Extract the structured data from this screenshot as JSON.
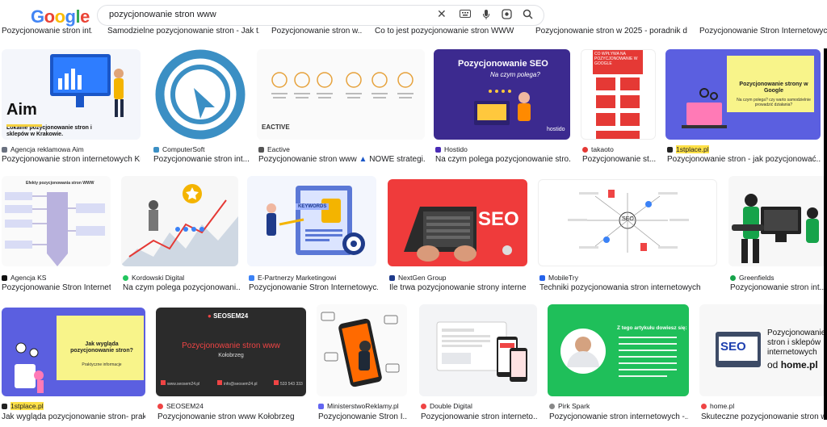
{
  "logo": {
    "text": "Google"
  },
  "search": {
    "query": "pozycjonowanie stron www"
  },
  "top_captions": [
    "Pozycjonowanie stron int...",
    "Samodzielne pozycjonowanie stron - Jak t...",
    "Pozycjonowanie stron w...",
    "Co to jest pozycjonowanie stron WWW ?",
    "Pozycjonowanie stron w 2025 - poradnik d...",
    "Pozycjonowanie Stron Internetowych -"
  ],
  "row1": [
    {
      "source": "Agencja reklamowa Aim",
      "caption": "Pozycjonowanie stron internetowych Kr...",
      "img_text": "Lokalne pozycjonowanie stron i sklepów w Krakowie.",
      "brand": "Aim"
    },
    {
      "source": "ComputerSoft",
      "caption": "Pozycjonowanie stron int..."
    },
    {
      "source": "Eactive",
      "caption": "Pozycjonowanie stron www",
      "caption2": "NOWE strategi...",
      "brand": "EACTIVE"
    },
    {
      "source": "Hostido",
      "caption": "Na czym polega pozycjonowanie stro...",
      "img_title": "Pozycjonowanie SEO",
      "img_sub": "Na czym polega?",
      "brand": "hostido"
    },
    {
      "source": "takaoto",
      "caption": "Pozycjonowanie st...",
      "img_text": "CO WPŁYWA NA POZYCJONOWANIE W GOOGLE"
    },
    {
      "source": "1stplace.pl",
      "caption": "Pozycjonowanie stron - jak pozycjonować...",
      "img_title": "Pozycjonowanie strony w Google",
      "img_sub": "Na czym polega? czy warto samodzielnie prowadzić działania?"
    }
  ],
  "row2": [
    {
      "source": "Agencja KS",
      "caption": "Pozycjonowanie Stron Internet...",
      "img_title": "Efekty pozycjonowania stron WWW"
    },
    {
      "source": "Kordowski Digital",
      "caption": "Na czym polega pozycjonowani..."
    },
    {
      "source": "E-Partnerzy Marketingowi",
      "caption": "Pozycjonowanie Stron Internetowyc...",
      "img_text": "KEYWORDS"
    },
    {
      "source": "NextGen Group",
      "caption": "Ile trwa pozycjonowanie strony interne...",
      "img_text": "SEO"
    },
    {
      "source": "MobileTry",
      "caption": "Techniki pozycjonowania stron internetowych",
      "img_text": "SEO"
    },
    {
      "source": "Greenfields",
      "caption": "Pozycjonowanie stron int..."
    }
  ],
  "row3": [
    {
      "source": "1stplace.pl",
      "caption": "Jak wygląda pozycjonowanie stron- prak...",
      "img_title": "Jak wygląda pozycjonowanie stron?",
      "img_sub": "Praktyczne informacje"
    },
    {
      "source": "SEOSEM24",
      "caption": "Pozycjonowanie stron www Kołobrzeg",
      "img_title": "Pozycjonowanie stron www",
      "img_sub": "Kołobrzeg",
      "brand": "SEOSEM24",
      "footer1": "www.seosem24.pl",
      "footer2": "info@seosem24.pl",
      "footer3": "533 543 333"
    },
    {
      "source": "MinisterstwoReklamy.pl",
      "caption": "Pozycjonowanie Stron I..."
    },
    {
      "source": "Double Digital",
      "caption": "Pozycjonowanie stron interneto..."
    },
    {
      "source": "Pirk Spark",
      "caption": "Pozycjonowanie stron internetowych -...",
      "img_title": "Z tego artykułu dowiesz się:"
    },
    {
      "source": "home.pl",
      "caption": "Skuteczne pozycjonowanie stron w...",
      "img_title": "Pozycjonowanie stron i sklepów internetowych",
      "img_sub": "od",
      "img_brand": "home.pl",
      "img_seo": "SEO"
    }
  ],
  "colors": {
    "blue": "#4285f4",
    "red": "#ea4335",
    "yellow": "#fbbc05",
    "green": "#34a853"
  }
}
